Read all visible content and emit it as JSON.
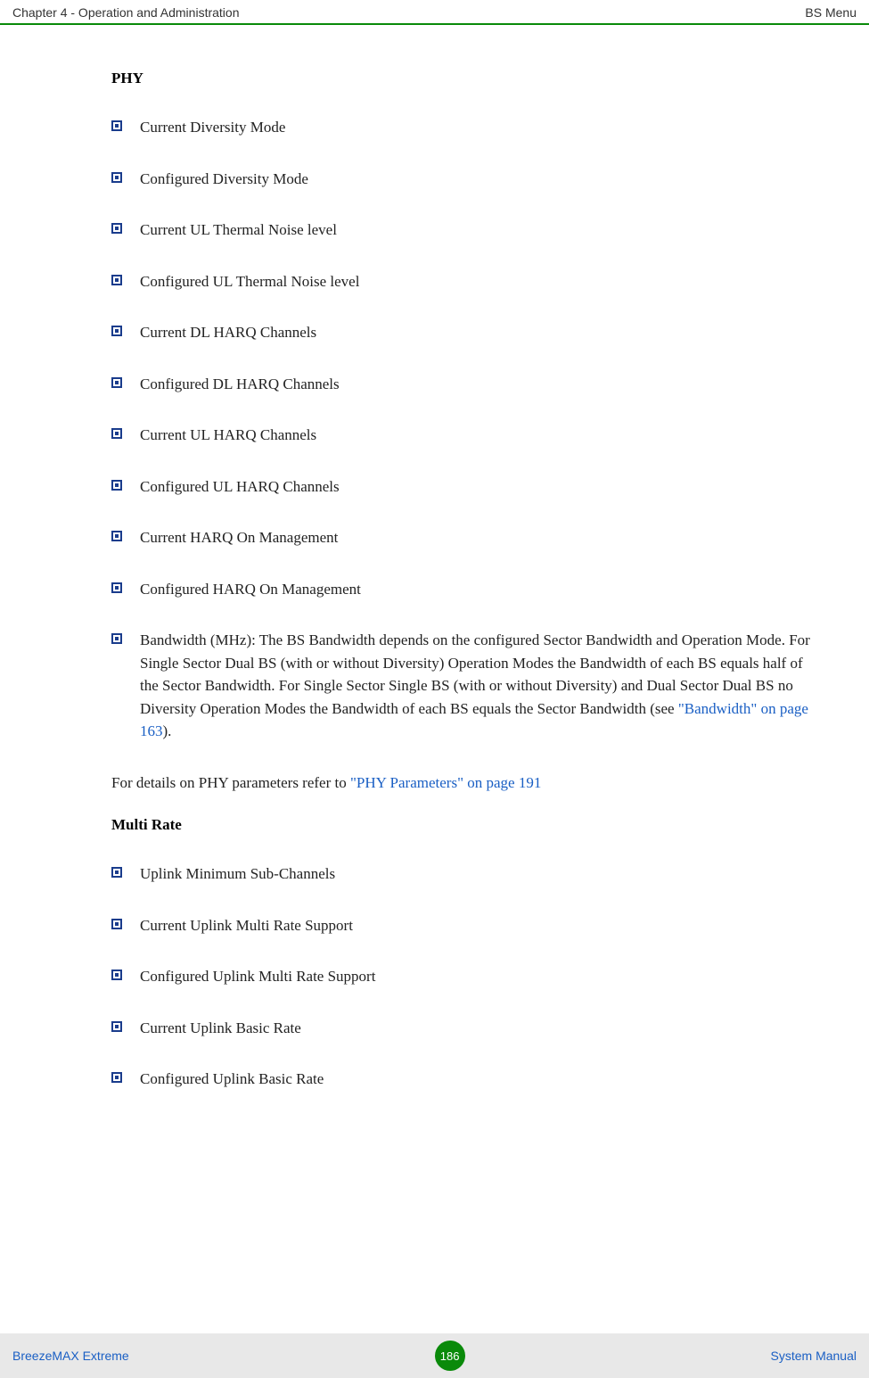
{
  "header": {
    "left": "Chapter 4 - Operation and Administration",
    "right": "BS Menu"
  },
  "sections": {
    "phy": {
      "title": "PHY",
      "items": {
        "i0": "Current Diversity Mode",
        "i1": "Configured Diversity Mode",
        "i2": "Current UL Thermal Noise level",
        "i3": "Configured UL Thermal Noise level",
        "i4": "Current DL HARQ Channels",
        "i5": "Configured DL HARQ Channels",
        "i6": "Current UL HARQ Channels",
        "i7": "Configured UL HARQ Channels",
        "i8": "Current HARQ On Management",
        "i9": "Configured HARQ On Management",
        "i10_pre": "Bandwidth (MHz): The BS Bandwidth depends on the configured Sector Bandwidth and Operation Mode. For Single Sector Dual BS (with or without Diversity) Operation Modes the Bandwidth of each BS equals half of the Sector Bandwidth. For Single Sector Single BS (with or without Diversity) and Dual Sector Dual BS no Diversity Operation Modes the Bandwidth of each BS equals the Sector Bandwidth (see ",
        "i10_link": "\"Bandwidth\" on page 163",
        "i10_post": ")."
      },
      "closing_pre": "For details on PHY parameters refer to ",
      "closing_link": "\"PHY Parameters\" on page 191"
    },
    "multirate": {
      "title": "Multi Rate",
      "items": {
        "i0": "Uplink Minimum Sub-Channels",
        "i1": "Current Uplink Multi Rate Support",
        "i2": "Configured Uplink Multi Rate Support",
        "i3": "Current Uplink Basic Rate",
        "i4": "Configured Uplink Basic Rate"
      }
    }
  },
  "footer": {
    "left": "BreezeMAX Extreme",
    "page": "186",
    "right": "System Manual"
  }
}
